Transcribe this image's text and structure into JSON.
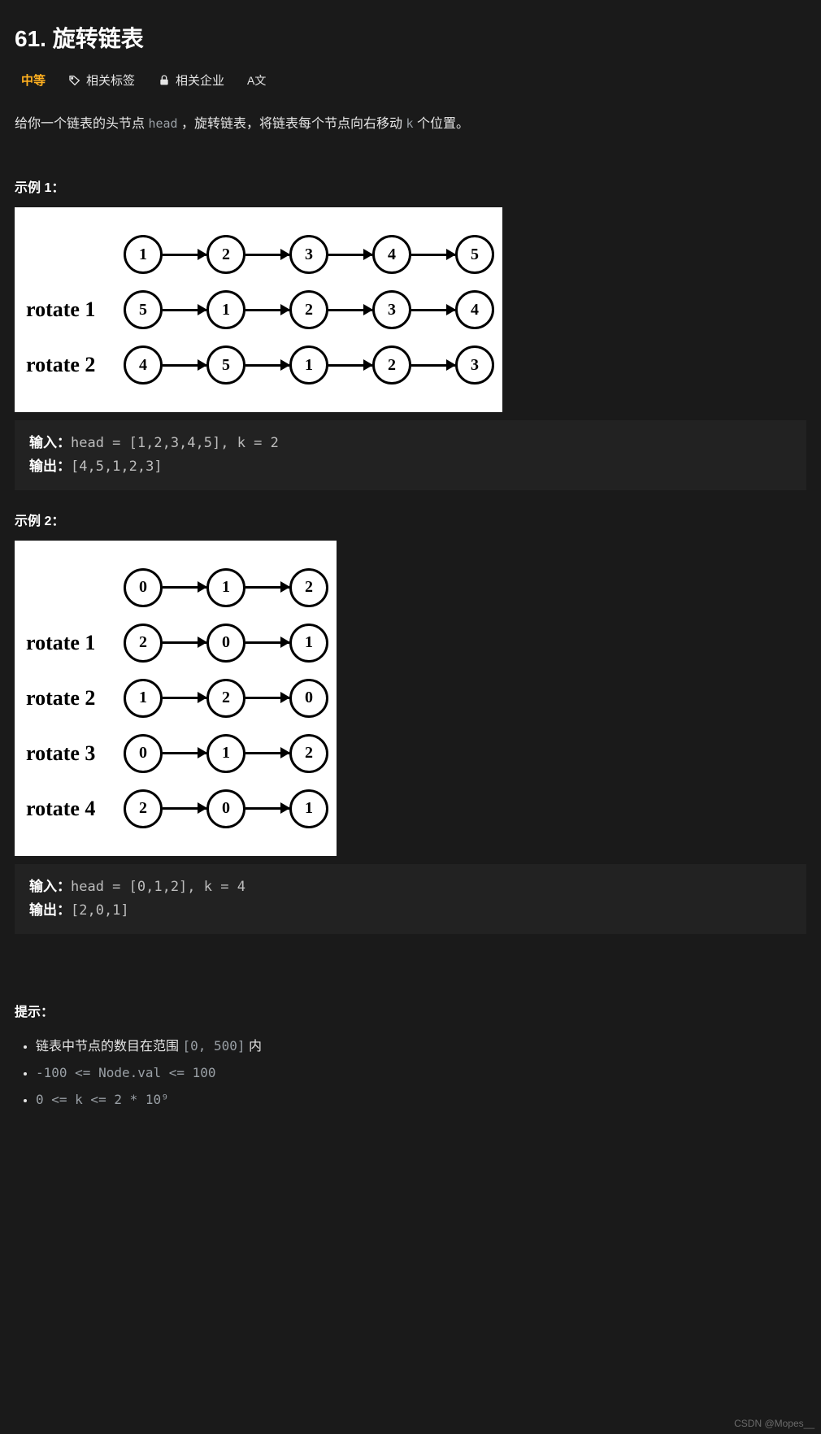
{
  "title": "61. 旋转链表",
  "meta": {
    "difficulty": "中等",
    "tags_label": "相关标签",
    "companies_label": "相关企业"
  },
  "description": {
    "prefix": "给你一个链表的头节点 ",
    "head_var": "head",
    "mid": " ，旋转链表，将链表每个节点向右移动 ",
    "k_var": "k",
    "suffix": " 个位置。"
  },
  "example1": {
    "heading": "示例 1：",
    "io": {
      "input_label": "输入：",
      "input_value": "head = [1,2,3,4,5], k = 2",
      "output_label": "输出：",
      "output_value": "[4,5,1,2,3]"
    }
  },
  "example2": {
    "heading": "示例 2：",
    "io": {
      "input_label": "输入：",
      "input_value": "head = [0,1,2], k = 4",
      "output_label": "输出：",
      "output_value": "[2,0,1]"
    }
  },
  "hints": {
    "heading": "提示：",
    "item1_prefix": "链表中节点的数目在范围 ",
    "item1_code": "[0, 500]",
    "item1_suffix": " 内",
    "item2": "-100 <= Node.val <= 100",
    "item3": "0 <= k <= 2 * 10⁹"
  },
  "chart_data": [
    {
      "type": "linked-list-rotation",
      "title": "Example 1",
      "rows": [
        {
          "label": "",
          "nodes": [
            1,
            2,
            3,
            4,
            5
          ]
        },
        {
          "label": "rotate 1",
          "nodes": [
            5,
            1,
            2,
            3,
            4
          ]
        },
        {
          "label": "rotate 2",
          "nodes": [
            4,
            5,
            1,
            2,
            3
          ]
        }
      ]
    },
    {
      "type": "linked-list-rotation",
      "title": "Example 2",
      "rows": [
        {
          "label": "",
          "nodes": [
            0,
            1,
            2
          ]
        },
        {
          "label": "rotate 1",
          "nodes": [
            2,
            0,
            1
          ]
        },
        {
          "label": "rotate 2",
          "nodes": [
            1,
            2,
            0
          ]
        },
        {
          "label": "rotate 3",
          "nodes": [
            0,
            1,
            2
          ]
        },
        {
          "label": "rotate 4",
          "nodes": [
            2,
            0,
            1
          ]
        }
      ]
    }
  ],
  "watermark": "CSDN @Mopes__"
}
